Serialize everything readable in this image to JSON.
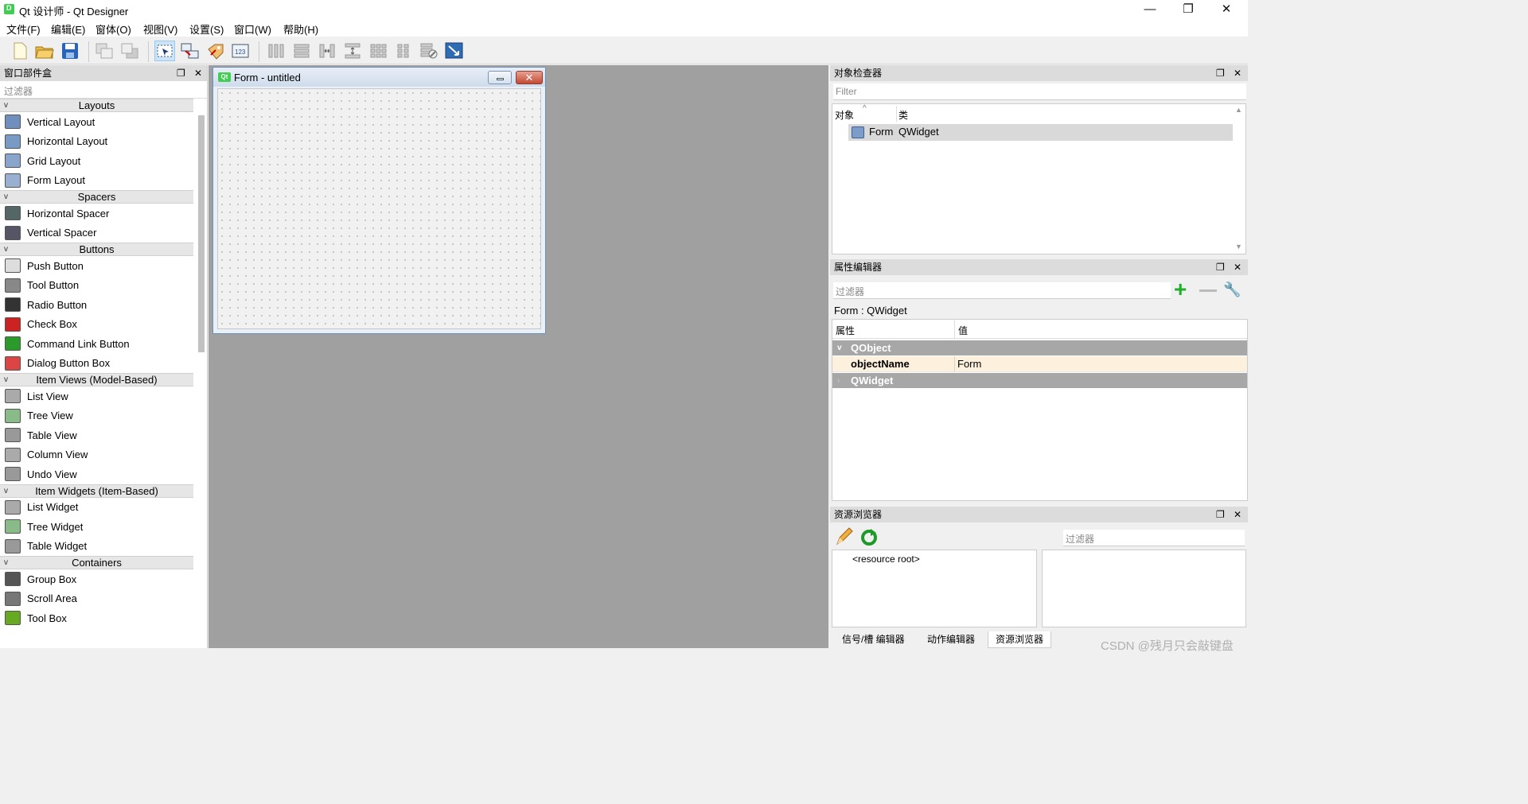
{
  "window": {
    "title": "Qt 设计师 - Qt Designer",
    "controls": [
      "—",
      "❐",
      "✕"
    ]
  },
  "menu": [
    "文件(F)",
    "编辑(E)",
    "窗体(O)",
    "视图(V)",
    "设置(S)",
    "窗口(W)",
    "帮助(H)"
  ],
  "toolbar": {
    "buttons": [
      "new-file",
      "open-file",
      "save-file",
      "send-to-back",
      "bring-to-front",
      "edit-widgets",
      "edit-signals-slots",
      "edit-buddies",
      "edit-tab-order",
      "lay-out-horizontally",
      "lay-out-vertically",
      "lay-out-horizontally-splitter",
      "lay-out-vertically-splitter",
      "lay-out-grid",
      "lay-out-form",
      "break-layout",
      "adjust-size"
    ],
    "selected": "edit-widgets"
  },
  "widgetbox": {
    "title": "窗口部件盒",
    "filter_placeholder": "过滤器",
    "categories": [
      {
        "name": "Layouts",
        "items": [
          "Vertical Layout",
          "Horizontal Layout",
          "Grid Layout",
          "Form Layout"
        ]
      },
      {
        "name": "Spacers",
        "items": [
          "Horizontal Spacer",
          "Vertical Spacer"
        ]
      },
      {
        "name": "Buttons",
        "items": [
          "Push Button",
          "Tool Button",
          "Radio Button",
          "Check Box",
          "Command Link Button",
          "Dialog Button Box"
        ]
      },
      {
        "name": "Item Views (Model-Based)",
        "items": [
          "List View",
          "Tree View",
          "Table View",
          "Column View",
          "Undo View"
        ]
      },
      {
        "name": "Item Widgets (Item-Based)",
        "items": [
          "List Widget",
          "Tree Widget",
          "Table Widget"
        ]
      },
      {
        "name": "Containers",
        "items": [
          "Group Box",
          "Scroll Area",
          "Tool Box"
        ]
      }
    ]
  },
  "form": {
    "icon_text": "Qt",
    "title": "Form - untitled"
  },
  "object_inspector": {
    "title": "对象检查器",
    "filter_placeholder": "Filter",
    "col_object": "对象",
    "col_class": "类",
    "row_object": "Form",
    "row_class": "QWidget"
  },
  "property_editor": {
    "title": "属性编辑器",
    "filter_placeholder": "过滤器",
    "context": "Form : QWidget",
    "col_property": "属性",
    "col_value": "值",
    "group_qobject": "QObject",
    "prop_name": "objectName",
    "prop_value": "Form",
    "group_qwidget": "QWidget"
  },
  "resource_browser": {
    "title": "资源浏览器",
    "filter_placeholder": "过滤器",
    "root": "<resource root>"
  },
  "bottom_tabs": [
    "信号/槽 编辑器",
    "动作编辑器",
    "资源浏览器"
  ],
  "watermark": "CSDN @残月只会敲键盘",
  "colors": {
    "accent": "#41cd52",
    "selection": "#cce4f7",
    "group_header": "#a7a7a7",
    "highlight_row": "#fdf0dc"
  }
}
